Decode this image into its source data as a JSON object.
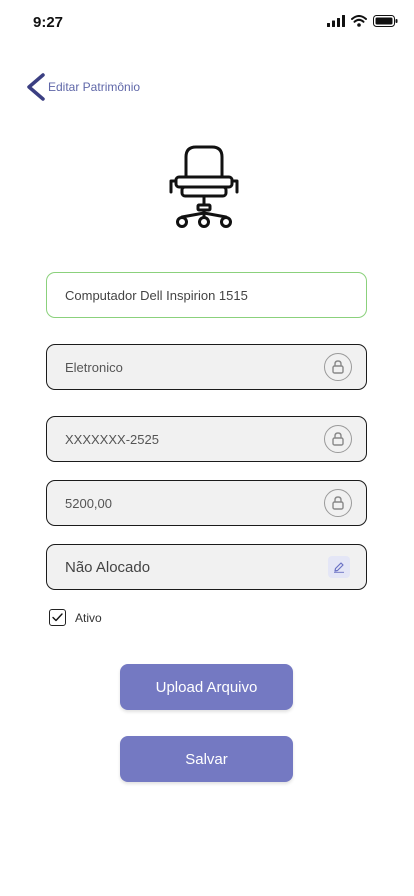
{
  "status_bar": {
    "time": "9:27"
  },
  "header": {
    "title": "Editar Patrimônio",
    "back_icon": "chevron-left-icon"
  },
  "asset_icon": "office-chair-icon",
  "form": {
    "name_value": "Computador Dell Inspirion 1515",
    "category_value": "Eletronico",
    "serial_value": "XXXXXXX-2525",
    "price_value": "5200,00",
    "location_value": "Não Alocado",
    "active_checked": true,
    "active_label": "Ativo"
  },
  "actions": {
    "upload_label": "Upload Arquivo",
    "save_label": "Salvar"
  },
  "colors": {
    "accent": "#7479c2",
    "title": "#5f67a8",
    "active_border": "#8bd17c",
    "field_bg": "#f1f1f1"
  }
}
